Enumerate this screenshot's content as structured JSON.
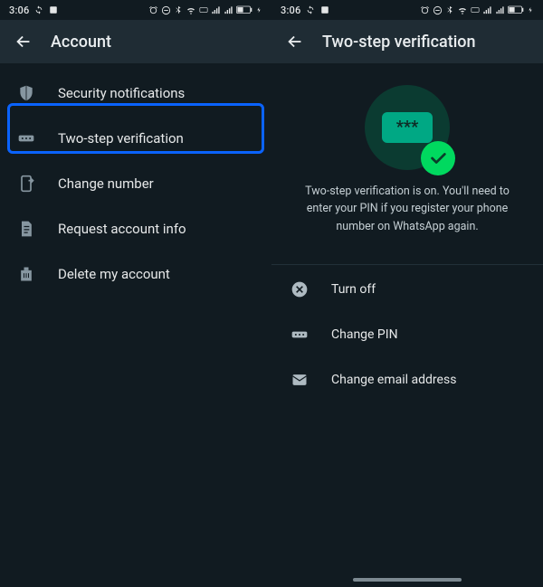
{
  "status_time": "3:06",
  "left": {
    "title": "Account",
    "items": [
      {
        "label": "Security notifications"
      },
      {
        "label": "Two-step verification"
      },
      {
        "label": "Change number"
      },
      {
        "label": "Request account info"
      },
      {
        "label": "Delete my account"
      }
    ],
    "highlight_label": "Two-step verification"
  },
  "right": {
    "title": "Two-step verification",
    "pin_mask": "***",
    "description": "Two-step verification is on. You'll need to enter your PIN if you register your phone number on WhatsApp again.",
    "actions": [
      {
        "label": "Turn off"
      },
      {
        "label": "Change PIN"
      },
      {
        "label": "Change email address"
      }
    ]
  }
}
